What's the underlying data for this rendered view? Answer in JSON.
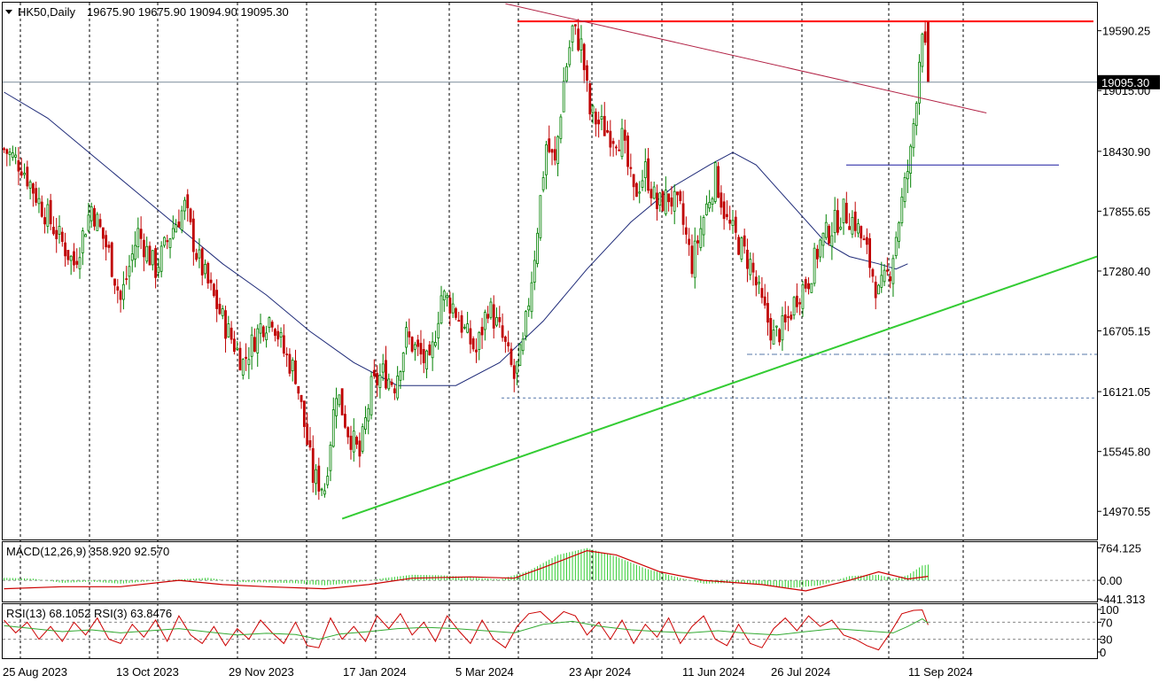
{
  "header": {
    "symbol_timeframe": "HK50,Daily",
    "ohlc": "19675.90 19675.90 19094.90 19095.30"
  },
  "colors": {
    "bull": "#008000",
    "bear": "#c00000",
    "ma": "#1e2a78",
    "resistance": "#ff0000",
    "downtrend": "#b22245",
    "uptrend": "#33cc33",
    "breakout": "#1a1aa0",
    "grid": "#000000",
    "macd_hist": "#33cc33",
    "macd_signal": "#cc0000",
    "rsi13": "#33aa33",
    "rsi3": "#cc0000"
  },
  "chart_data": [
    {
      "type": "candlestick",
      "panel": "price",
      "title": "HK50,Daily",
      "ohlc_last": {
        "open": 19675.9,
        "high": 19675.9,
        "low": 19094.9,
        "close": 19095.3
      },
      "x_labels": [
        "25 Aug 2023",
        "13 Oct 2023",
        "29 Nov 2023",
        "17 Jan 2024",
        "5 Mar 2024",
        "23 Apr 2024",
        "11 Jun 2024",
        "26 Jul 2024",
        "11 Sep 2024"
      ],
      "y_ticks": [
        19590.25,
        19015.0,
        18430.9,
        17855.65,
        17280.4,
        16705.15,
        16121.05,
        15545.8,
        14970.55
      ],
      "y_tick_labels": [
        "19590.25",
        "19015.00",
        "18430.90",
        "17855.65",
        "17280.40",
        "16705.15",
        "16121.05",
        "15545.80",
        "14970.55"
      ],
      "ylim": [
        14700,
        19860
      ],
      "current_price": 19095.3,
      "current_price_label": "19095.30",
      "close_path": [
        [
          0,
          18450
        ],
        [
          6,
          18300
        ],
        [
          12,
          17950
        ],
        [
          18,
          17650
        ],
        [
          24,
          17350
        ],
        [
          30,
          17900
        ],
        [
          36,
          17450
        ],
        [
          40,
          17000
        ],
        [
          46,
          17650
        ],
        [
          52,
          17300
        ],
        [
          58,
          17700
        ],
        [
          62,
          17900
        ],
        [
          66,
          17450
        ],
        [
          70,
          17150
        ],
        [
          76,
          16750
        ],
        [
          82,
          16400
        ],
        [
          88,
          16750
        ],
        [
          92,
          16850
        ],
        [
          96,
          16500
        ],
        [
          100,
          16300
        ],
        [
          106,
          15300
        ],
        [
          110,
          15200
        ],
        [
          114,
          16150
        ],
        [
          118,
          15750
        ],
        [
          122,
          15500
        ],
        [
          126,
          16150
        ],
        [
          130,
          16300
        ],
        [
          134,
          16200
        ],
        [
          138,
          16650
        ],
        [
          142,
          16500
        ],
        [
          146,
          16350
        ],
        [
          150,
          17050
        ],
        [
          154,
          16950
        ],
        [
          158,
          16700
        ],
        [
          162,
          16500
        ],
        [
          166,
          16950
        ],
        [
          170,
          16700
        ],
        [
          172,
          16550
        ],
        [
          175,
          16250
        ],
        [
          178,
          16550
        ],
        [
          182,
          17450
        ],
        [
          186,
          18500
        ],
        [
          189,
          18300
        ],
        [
          192,
          19100
        ],
        [
          195,
          19600
        ],
        [
          198,
          19450
        ],
        [
          201,
          18800
        ],
        [
          204,
          18700
        ],
        [
          208,
          18600
        ],
        [
          212,
          18550
        ],
        [
          216,
          18000
        ],
        [
          220,
          18250
        ],
        [
          224,
          17900
        ],
        [
          228,
          18000
        ],
        [
          232,
          17850
        ],
        [
          236,
          17350
        ],
        [
          240,
          17800
        ],
        [
          244,
          18200
        ],
        [
          248,
          17750
        ],
        [
          252,
          17550
        ],
        [
          256,
          17350
        ],
        [
          260,
          16950
        ],
        [
          264,
          16650
        ],
        [
          268,
          16750
        ],
        [
          272,
          17050
        ],
        [
          276,
          17200
        ],
        [
          280,
          17550
        ],
        [
          284,
          17700
        ],
        [
          288,
          17850
        ],
        [
          292,
          17750
        ],
        [
          296,
          17450
        ],
        [
          300,
          17050
        ],
        [
          304,
          17300
        ],
        [
          308,
          17950
        ],
        [
          311,
          18400
        ],
        [
          313,
          19000
        ],
        [
          315,
          19650
        ],
        [
          317,
          19095.3
        ]
      ],
      "moving_average": [
        [
          0,
          19000
        ],
        [
          15,
          18750
        ],
        [
          30,
          18400
        ],
        [
          45,
          18050
        ],
        [
          60,
          17700
        ],
        [
          75,
          17350
        ],
        [
          90,
          17050
        ],
        [
          105,
          16700
        ],
        [
          120,
          16400
        ],
        [
          135,
          16180
        ],
        [
          155,
          16180
        ],
        [
          170,
          16400
        ],
        [
          185,
          16800
        ],
        [
          200,
          17300
        ],
        [
          215,
          17750
        ],
        [
          230,
          18100
        ],
        [
          242,
          18300
        ],
        [
          250,
          18420
        ],
        [
          258,
          18300
        ],
        [
          266,
          18050
        ],
        [
          274,
          17800
        ],
        [
          282,
          17550
        ],
        [
          290,
          17420
        ],
        [
          300,
          17350
        ],
        [
          306,
          17300
        ],
        [
          310,
          17350
        ]
      ],
      "annotations": {
        "resistance_level": 19680,
        "downtrend_line": [
          [
            172,
            19850
          ],
          [
            337,
            18800
          ]
        ],
        "uptrend_line": [
          [
            116,
            14900
          ],
          [
            360,
            17420
          ]
        ],
        "breakout_level": {
          "from": 278,
          "to": 348,
          "value": 18300
        },
        "support_level_1": {
          "from": 246,
          "value": 16480
        },
        "support_level_2": {
          "from": 165,
          "value": 16060
        }
      }
    },
    {
      "type": "bar+line",
      "panel": "macd",
      "label": "MACD(12,26,9) 358.920 92.570",
      "y_ticks": [
        764.125,
        0.0,
        -441.313
      ],
      "y_tick_labels": [
        "764.125",
        "0.00",
        "-441.313"
      ],
      "ylim": [
        -500,
        900
      ],
      "histogram": [
        [
          0,
          60
        ],
        [
          10,
          40
        ],
        [
          20,
          -60
        ],
        [
          30,
          -30
        ],
        [
          40,
          -80
        ],
        [
          50,
          -20
        ],
        [
          60,
          20
        ],
        [
          70,
          60
        ],
        [
          80,
          -40
        ],
        [
          90,
          -50
        ],
        [
          100,
          -70
        ],
        [
          110,
          -120
        ],
        [
          120,
          -60
        ],
        [
          130,
          50
        ],
        [
          140,
          130
        ],
        [
          150,
          120
        ],
        [
          160,
          70
        ],
        [
          170,
          20
        ],
        [
          180,
          220
        ],
        [
          190,
          600
        ],
        [
          200,
          760
        ],
        [
          210,
          560
        ],
        [
          220,
          280
        ],
        [
          230,
          90
        ],
        [
          240,
          -80
        ],
        [
          250,
          -60
        ],
        [
          260,
          -110
        ],
        [
          270,
          -180
        ],
        [
          280,
          -120
        ],
        [
          290,
          100
        ],
        [
          300,
          130
        ],
        [
          305,
          40
        ],
        [
          310,
          120
        ],
        [
          315,
          350
        ],
        [
          317,
          370
        ]
      ],
      "signal": [
        [
          0,
          -200
        ],
        [
          20,
          -150
        ],
        [
          40,
          -150
        ],
        [
          60,
          0
        ],
        [
          75,
          -100
        ],
        [
          90,
          -150
        ],
        [
          110,
          -200
        ],
        [
          125,
          -100
        ],
        [
          140,
          50
        ],
        [
          160,
          80
        ],
        [
          175,
          50
        ],
        [
          185,
          300
        ],
        [
          200,
          700
        ],
        [
          210,
          600
        ],
        [
          225,
          200
        ],
        [
          240,
          0
        ],
        [
          260,
          -100
        ],
        [
          275,
          -250
        ],
        [
          290,
          0
        ],
        [
          300,
          200
        ],
        [
          310,
          30
        ],
        [
          317,
          92.57
        ]
      ]
    },
    {
      "type": "line",
      "panel": "rsi",
      "label": "RSI(13) 68.1052 RSI(3) 63.8476",
      "y_ticks": [
        100,
        70,
        30,
        0
      ],
      "y_tick_labels": [
        "100",
        "70",
        "30",
        "0"
      ],
      "ylim": [
        0,
        100
      ],
      "levels": [
        70,
        30
      ],
      "rsi13": [
        [
          0,
          62
        ],
        [
          10,
          55
        ],
        [
          20,
          48
        ],
        [
          30,
          52
        ],
        [
          40,
          45
        ],
        [
          50,
          50
        ],
        [
          60,
          55
        ],
        [
          70,
          47
        ],
        [
          80,
          40
        ],
        [
          90,
          44
        ],
        [
          100,
          41
        ],
        [
          108,
          30
        ],
        [
          115,
          42
        ],
        [
          125,
          48
        ],
        [
          135,
          55
        ],
        [
          145,
          58
        ],
        [
          155,
          55
        ],
        [
          165,
          50
        ],
        [
          175,
          45
        ],
        [
          185,
          65
        ],
        [
          195,
          72
        ],
        [
          205,
          60
        ],
        [
          215,
          52
        ],
        [
          225,
          48
        ],
        [
          235,
          45
        ],
        [
          245,
          50
        ],
        [
          255,
          44
        ],
        [
          265,
          40
        ],
        [
          275,
          48
        ],
        [
          285,
          55
        ],
        [
          295,
          50
        ],
        [
          305,
          45
        ],
        [
          310,
          60
        ],
        [
          315,
          78
        ],
        [
          317,
          68.1
        ]
      ],
      "rsi3": [
        [
          0,
          75
        ],
        [
          4,
          45
        ],
        [
          8,
          70
        ],
        [
          12,
          30
        ],
        [
          16,
          60
        ],
        [
          20,
          25
        ],
        [
          24,
          70
        ],
        [
          28,
          40
        ],
        [
          32,
          80
        ],
        [
          36,
          30
        ],
        [
          40,
          20
        ],
        [
          44,
          65
        ],
        [
          48,
          35
        ],
        [
          52,
          75
        ],
        [
          56,
          25
        ],
        [
          60,
          85
        ],
        [
          64,
          40
        ],
        [
          68,
          20
        ],
        [
          72,
          60
        ],
        [
          76,
          15
        ],
        [
          80,
          55
        ],
        [
          84,
          30
        ],
        [
          88,
          75
        ],
        [
          92,
          45
        ],
        [
          96,
          20
        ],
        [
          100,
          70
        ],
        [
          104,
          15
        ],
        [
          108,
          10
        ],
        [
          112,
          80
        ],
        [
          116,
          30
        ],
        [
          120,
          60
        ],
        [
          124,
          25
        ],
        [
          128,
          85
        ],
        [
          132,
          55
        ],
        [
          136,
          90
        ],
        [
          140,
          40
        ],
        [
          144,
          70
        ],
        [
          148,
          25
        ],
        [
          152,
          85
        ],
        [
          156,
          50
        ],
        [
          160,
          20
        ],
        [
          164,
          75
        ],
        [
          168,
          30
        ],
        [
          172,
          10
        ],
        [
          176,
          60
        ],
        [
          180,
          90
        ],
        [
          184,
          95
        ],
        [
          188,
          70
        ],
        [
          192,
          95
        ],
        [
          196,
          85
        ],
        [
          200,
          40
        ],
        [
          204,
          70
        ],
        [
          208,
          30
        ],
        [
          212,
          75
        ],
        [
          216,
          20
        ],
        [
          220,
          65
        ],
        [
          224,
          35
        ],
        [
          228,
          80
        ],
        [
          232,
          20
        ],
        [
          236,
          60
        ],
        [
          240,
          85
        ],
        [
          244,
          30
        ],
        [
          248,
          15
        ],
        [
          252,
          65
        ],
        [
          256,
          20
        ],
        [
          260,
          10
        ],
        [
          264,
          55
        ],
        [
          268,
          80
        ],
        [
          272,
          50
        ],
        [
          276,
          85
        ],
        [
          280,
          60
        ],
        [
          284,
          75
        ],
        [
          288,
          40
        ],
        [
          292,
          30
        ],
        [
          296,
          15
        ],
        [
          300,
          5
        ],
        [
          304,
          45
        ],
        [
          308,
          90
        ],
        [
          312,
          98
        ],
        [
          315,
          99
        ],
        [
          317,
          63.8
        ]
      ]
    }
  ]
}
